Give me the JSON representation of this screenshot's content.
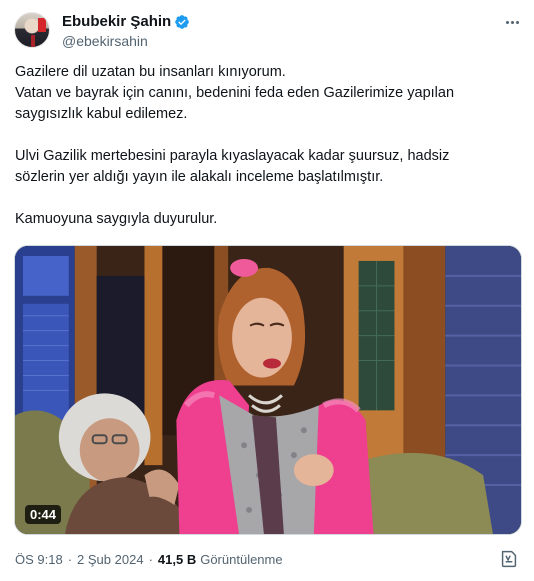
{
  "author": {
    "display_name": "Ebubekir Şahin",
    "handle": "@ebekirsahin",
    "verified": true,
    "verified_color": "#1d9bf0"
  },
  "tweet": {
    "lines": [
      "Gazilere dil uzatan bu insanları kınıyorum.",
      "Vatan ve bayrak için canını, bedenini feda eden Gazilerimize yapılan",
      "saygısızlık kabul edilemez.",
      "",
      "Ulvi Gazilik mertebesini parayla kıyaslayacak kadar şuursuz, hadsiz",
      "sözlerin yer aldığı yayın ile alakalı inceleme başlatılmıştır.",
      "",
      "Kamuoyuna saygıyla duyurulur."
    ]
  },
  "media": {
    "type": "video",
    "duration": "0:44"
  },
  "meta": {
    "time": "ÖS 9:18",
    "separator": "·",
    "date": "2 Şub 2024",
    "views_count": "41,5 B",
    "views_label": "Görüntülenme"
  },
  "icons": {
    "more": "more-options-icon",
    "verified": "verified-badge-icon",
    "grok": "grok-icon"
  }
}
